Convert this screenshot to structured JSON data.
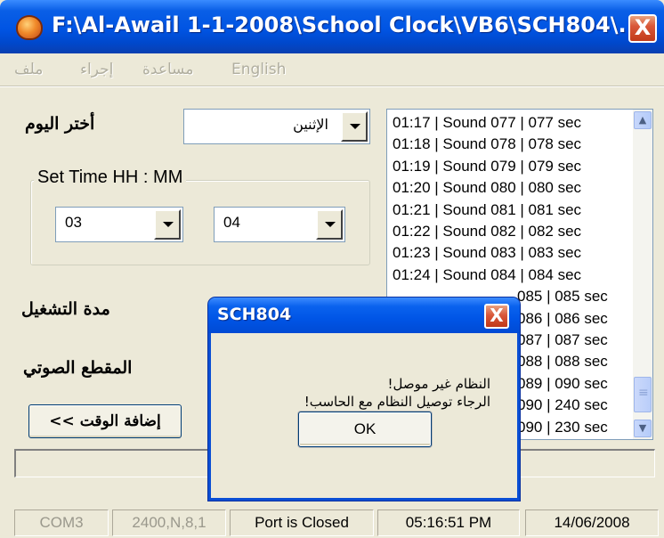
{
  "window": {
    "title": "F:\\Al-Awail 1-1-2008\\School Clock\\VB6\\SCH804\\...",
    "close_label": "X",
    "icon": "app-icon"
  },
  "menu": {
    "file": "ملف",
    "action": "إجراء",
    "help": "مساعدة",
    "english": "English"
  },
  "form": {
    "day_label": "أختر اليوم",
    "day_value": "الإثنين",
    "set_time_label": "Set Time  HH : MM",
    "hour_value": "03",
    "minute_value": "04",
    "duration_label": "مدة التشغيل",
    "sound_label": "المقطع الصوتي",
    "add_time_button": "<< إضافة الوقت"
  },
  "list": {
    "items": [
      "01:17 | Sound 077 | 077 sec",
      "01:18 | Sound 078 | 078 sec",
      "01:19 | Sound 079 | 079 sec",
      "01:20 | Sound 080 | 080 sec",
      "01:21 | Sound 081 | 081 sec",
      "01:22 | Sound 082 | 082 sec",
      "01:23 | Sound 083 | 083 sec",
      "01:24 | Sound 084 | 084 sec",
      "085 | 085 sec",
      "086 | 086 sec",
      "087 | 087 sec",
      "088 | 088 sec",
      "089 | 090 sec",
      "090 | 240 sec",
      "090 | 230 sec"
    ]
  },
  "status": {
    "port": "COM3",
    "settings": "2400,N,8,1",
    "port_state": "Port is Closed",
    "time": "05:16:51 PM",
    "date": "14/06/2008"
  },
  "dialog": {
    "title": "SCH804",
    "close_label": "X",
    "line1": "!النظام غير موصل",
    "line2": "!الرجاء توصيل النظام مع الحاسب",
    "ok_label": "OK"
  },
  "colors": {
    "titlebar": "#0054e3",
    "face": "#ece9d8",
    "close": "#d9583a"
  }
}
